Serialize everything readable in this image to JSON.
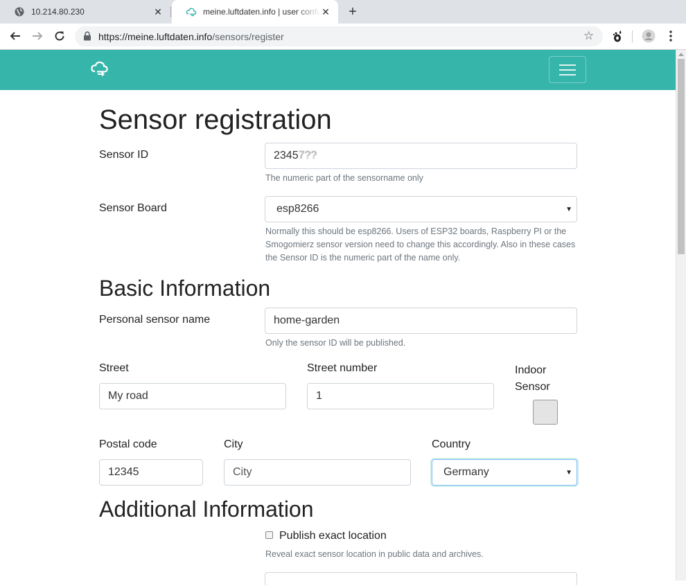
{
  "browser": {
    "tabs": [
      {
        "title": "10.214.80.230",
        "favicon": "globe-icon"
      },
      {
        "title": "meine.luftdaten.info | user configura",
        "favicon": "cloud-icon"
      }
    ],
    "url_host": "https://meine.luftdaten.info",
    "url_path": "/sensors/register"
  },
  "form": {
    "title": "Sensor registration",
    "sensor_id": {
      "label": "Sensor ID",
      "value": "2345",
      "value_obscured": "7??",
      "help": "The numeric part of the sensorname only"
    },
    "sensor_board": {
      "label": "Sensor Board",
      "value": "esp8266",
      "help": "Normally this should be esp8266. Users of ESP32 boards, Raspberry PI or the Smogomierz sensor version need to change this accordingly. Also in these cases the Sensor ID is the numeric part of the name only."
    },
    "basic": {
      "title": "Basic Information",
      "name": {
        "label": "Personal sensor name",
        "value": "home-garden",
        "help": "Only the sensor ID will be published."
      },
      "street": {
        "label": "Street",
        "value": "My road"
      },
      "street_number": {
        "label": "Street number",
        "value": "1"
      },
      "indoor": {
        "label_line1": "Indoor",
        "label_line2": "Sensor"
      },
      "postal_code": {
        "label": "Postal code",
        "value": "12345"
      },
      "city": {
        "label": "City",
        "placeholder": "City"
      },
      "country": {
        "label": "Country",
        "value": "Germany"
      }
    },
    "additional": {
      "title": "Additional Information",
      "publish": {
        "label": "Publish exact location",
        "help": "Reveal exact sensor location in public data and archives."
      }
    }
  },
  "colors": {
    "navbar": "#36b5aa",
    "focus": "#80bdff"
  }
}
